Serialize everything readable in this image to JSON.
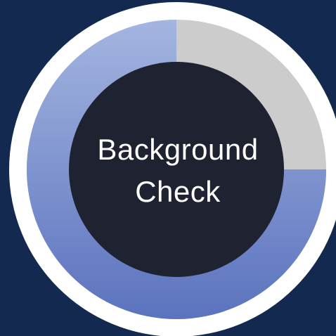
{
  "widget": {
    "label_line1": "Background",
    "label_line2": "Check",
    "progress_fraction": 0.75
  },
  "colors": {
    "background": "#13294f",
    "outer_ring": "#ffffff",
    "progress_top": "#a4b5e0",
    "progress_bottom": "#5b73be",
    "remaining": "#cccccc",
    "center_fill": "#1e2231",
    "label_text": "#ffffff"
  }
}
